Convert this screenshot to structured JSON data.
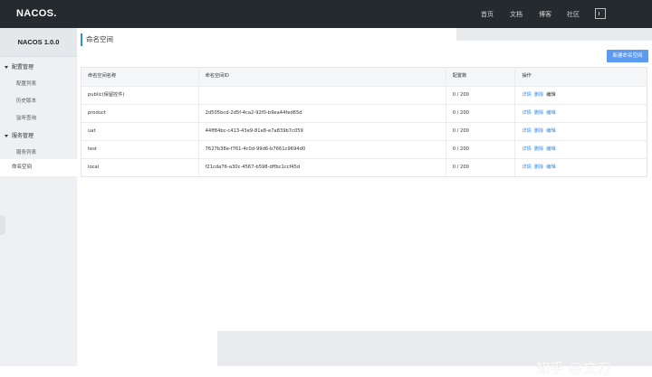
{
  "header": {
    "logo": "NACOS.",
    "nav": [
      "首页",
      "文档",
      "博客",
      "社区"
    ]
  },
  "sidebar": {
    "brand": "NACOS 1.0.0",
    "groups": [
      {
        "label": "配置管理",
        "items": [
          "配置列表",
          "历史版本",
          "监听查询"
        ]
      },
      {
        "label": "服务管理",
        "items": [
          "服务列表"
        ]
      }
    ],
    "active_item": "命名空间"
  },
  "main": {
    "title": "命名空间",
    "new_button": "新建命名空间",
    "columns": [
      "命名空间名称",
      "命名空间ID",
      "配置数",
      "操作"
    ],
    "rows": [
      {
        "name": "public(保留控件)",
        "id": "",
        "count": "0 / 200"
      },
      {
        "name": "product",
        "id": "2d505bcd-2d5f-4ca2-92f0-b9ea44fed65d",
        "count": "0 / 200"
      },
      {
        "name": "uat",
        "id": "44ff84bc-c413-43e9-81e8-e7a839b7c059",
        "count": "0 / 200"
      },
      {
        "name": "test",
        "id": "7627b38e-f761-4c0d-99d6-b7661c9694d0",
        "count": "0 / 200"
      },
      {
        "name": "local",
        "id": "f21cda76-a30c-4567-b598-dffbc1ccf45d",
        "count": "0 / 200"
      }
    ],
    "actions": [
      "详情",
      "删除",
      "编辑"
    ]
  },
  "watermark": "知乎 @文刀",
  "colors": {
    "topbar": "#252a2f",
    "accent": "#2d8cf0",
    "button": "#5b9af0"
  }
}
